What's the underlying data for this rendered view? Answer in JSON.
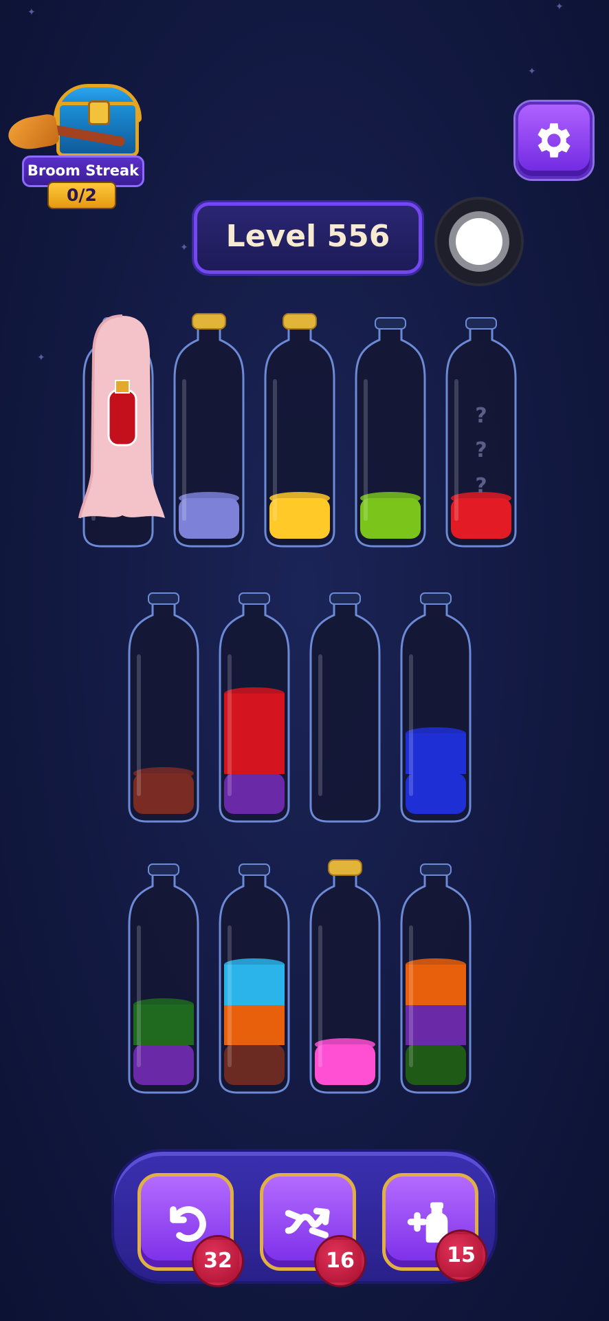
{
  "streak": {
    "title": "Broom Streak",
    "progress": "0/2"
  },
  "level": {
    "label": "Level 556"
  },
  "bottles": [
    {
      "layers": [],
      "mystery": false,
      "capped": false,
      "covered": true
    },
    {
      "layers": [
        "#7d82d8"
      ],
      "capped": true
    },
    {
      "layers": [
        "#ffc928"
      ],
      "capped": true
    },
    {
      "layers": [
        "#7ac41c"
      ],
      "capped": false
    },
    {
      "layers": [
        "#e21b24"
      ],
      "mystery": true,
      "capped": false
    },
    {
      "layers": [
        "#7a2b24"
      ],
      "capped": false
    },
    {
      "layers": [
        "#6a2aa8",
        "#d4141f",
        "#d4141f"
      ],
      "capped": false
    },
    {
      "layers": [],
      "capped": false
    },
    {
      "layers": [
        "#1f2fd6",
        "#1f2fd6"
      ],
      "capped": false
    },
    {
      "layers": [
        "#6a2aa8",
        "#1f6a1f"
      ],
      "capped": false
    },
    {
      "layers": [
        "#6b2a22",
        "#e8600c",
        "#2ab4ea"
      ],
      "capped": false
    },
    {
      "layers": [
        "#ff4fd2"
      ],
      "capped": true
    },
    {
      "layers": [
        "#1f5a16",
        "#6a2aa8",
        "#e8600c"
      ],
      "capped": false
    }
  ],
  "tools": [
    {
      "name": "undo",
      "count": "32"
    },
    {
      "name": "shuffle",
      "count": "16"
    },
    {
      "name": "add-bottle",
      "count": "15"
    }
  ],
  "icons": {
    "settings": "gear-icon",
    "undo": "undo-icon",
    "shuffle": "shuffle-icon",
    "add_bottle": "add-bottle-icon"
  }
}
